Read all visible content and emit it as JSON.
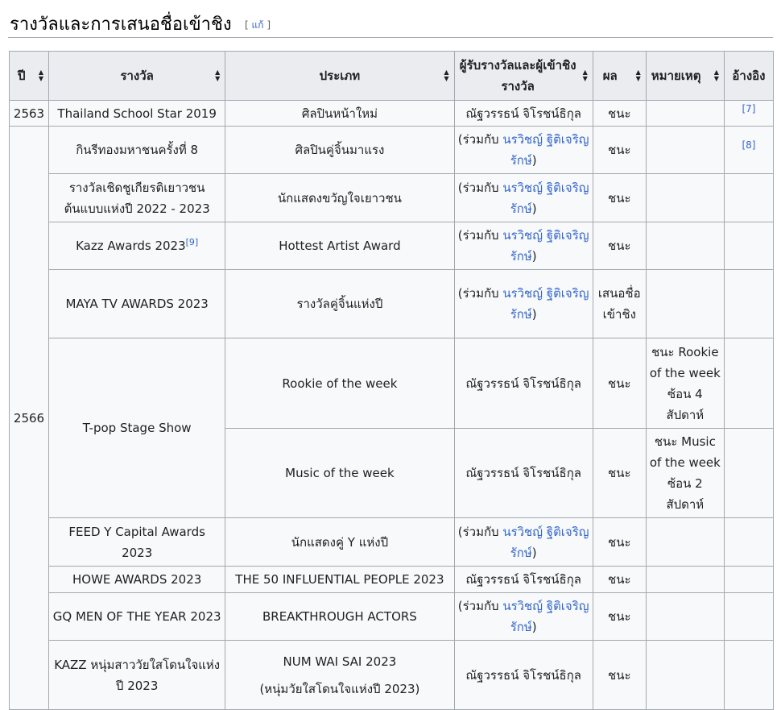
{
  "section": {
    "title": "รางวัลและการเสนอชื่อเข้าชิง",
    "edit_open": "[ ",
    "edit_label": "แก้",
    "edit_close": " ]"
  },
  "table": {
    "headers": [
      "ปี",
      "รางวัล",
      "ประเภท",
      "ผู้รับรางวัลและผู้เข้าชิงรางวัล",
      "ผล",
      "หมายเหตุ",
      "อ้างอิง"
    ],
    "years": [
      "2563",
      "2566"
    ],
    "with_prefix": "(ร่วมกับ ",
    "with_name": "นรวิชญ์ ฐิติเจริญรักษ์",
    "with_suffix": ")",
    "rows": [
      {
        "award": "Thailand School Star 2019",
        "category": "ศิลปินหน้าใหม่",
        "recipient": "ณัฐวรรธน์ จิโรชน์ธิกุล",
        "result": "ชนะ",
        "note": "",
        "ref": "[7]"
      },
      {
        "award": "กินรีทองมหาชนครั้งที่ 8",
        "category": "ศิลปินคู่จิ้นมาแรง",
        "recipient": "",
        "result": "ชนะ",
        "note": "",
        "ref": "[8]"
      },
      {
        "award": "รางวัลเชิดชูเกียรติเยาวชนต้นแบบแห่งปี 2022 - 2023",
        "category": "นักแสดงขวัญใจเยาวชน",
        "recipient": "",
        "result": "ชนะ",
        "note": "",
        "ref": ""
      },
      {
        "award": "Kazz Awards 2023",
        "award_sup": "[9]",
        "category": "Hottest Artist Award",
        "recipient": "",
        "result": "ชนะ",
        "note": "",
        "ref": ""
      },
      {
        "award": "MAYA TV AWARDS 2023",
        "category": "รางวัลคู่จิ้นแห่งปี",
        "recipient": "",
        "result": "เสนอชื่อเข้าชิง",
        "note": "",
        "ref": ""
      },
      {
        "award": "T-pop Stage Show",
        "category": "Rookie of the week",
        "recipient": "ณัฐวรรธน์ จิโรชน์ธิกุล",
        "result": "ชนะ",
        "note": "ชนะ Rookie of the week ซ้อน 4 สัปดาห์",
        "ref": ""
      },
      {
        "award": "",
        "category": "Music of the week",
        "recipient": "ณัฐวรรธน์ จิโรชน์ธิกุล",
        "result": "ชนะ",
        "note": "ชนะ Music of the week ซ้อน 2 สัปดาห์",
        "ref": ""
      },
      {
        "award": "FEED Y Capital Awards 2023",
        "category": "นักแสดงคู่ Y แห่งปี",
        "recipient": "",
        "result": "ชนะ",
        "note": "",
        "ref": ""
      },
      {
        "award": "HOWE AWARDS 2023",
        "category": "THE 50 INFLUENTIAL PEOPLE 2023",
        "recipient": "ณัฐวรรธน์ จิโรชน์ธิกุล",
        "result": "ชนะ",
        "note": "",
        "ref": ""
      },
      {
        "award": "GQ MEN OF THE YEAR 2023",
        "category": "BREAKTHROUGH ACTORS",
        "recipient": "",
        "result": "ชนะ",
        "note": "",
        "ref": ""
      },
      {
        "award": "KAZZ หนุ่มสาววัยใสโดนใจแห่งปี 2023",
        "category": "NUM WAI SAI 2023",
        "category_sub": "(หนุ่มวัยใสโดนใจแห่งปี 2023)",
        "recipient": "ณัฐวรรธน์ จิโรชน์ธิกุล",
        "result": "ชนะ",
        "note": "",
        "ref": ""
      }
    ]
  },
  "colors": {
    "win": "#99ff99",
    "nominated": "#ffdddd",
    "header_bg": "#eaecf0",
    "link": "#3366cc"
  }
}
